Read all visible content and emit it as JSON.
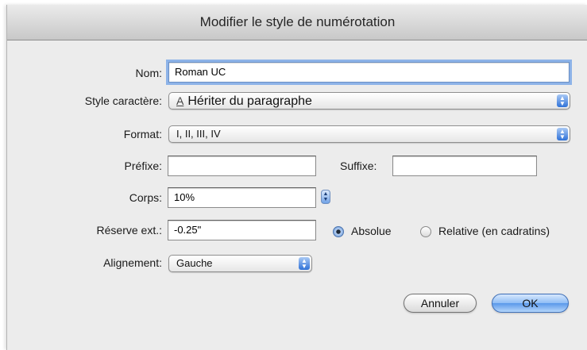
{
  "window": {
    "title": "Modifier le style de numérotation"
  },
  "form": {
    "nom": {
      "label": "Nom:",
      "value": "Roman UC"
    },
    "style_caractere": {
      "label": "Style caractère:",
      "icon": "character-style-icon",
      "icon_glyph": "A",
      "value": "Hériter du paragraphe"
    },
    "format": {
      "label": "Format:",
      "value": "I, II, III, IV"
    },
    "prefixe": {
      "label": "Préfixe:",
      "value": ""
    },
    "suffixe": {
      "label": "Suffixe:",
      "value": ""
    },
    "corps": {
      "label": "Corps:",
      "value": "10%"
    },
    "reserve_ext": {
      "label": "Réserve ext.:",
      "value": "-0.25\""
    },
    "radios": {
      "absolue": {
        "label": "Absolue",
        "checked": true
      },
      "relative": {
        "label": "Relative (en cadratins)",
        "checked": false
      }
    },
    "alignement": {
      "label": "Alignement:",
      "value": "Gauche"
    }
  },
  "buttons": {
    "cancel": "Annuler",
    "ok": "OK"
  },
  "colors": {
    "accent": "#5a98ea",
    "focus_ring": "#8db3e8",
    "dialog_bg": "#ececec"
  }
}
